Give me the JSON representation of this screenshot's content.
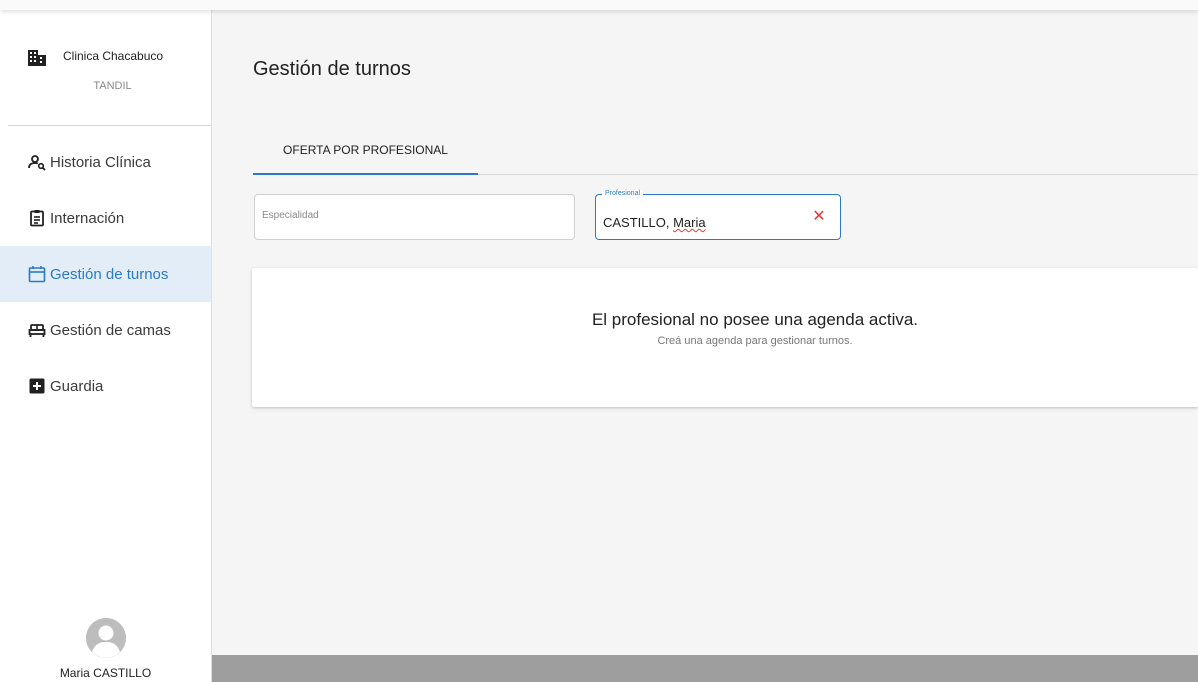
{
  "sidebar": {
    "clinic_name": "Clinica Chacabuco",
    "clinic_city": "TANDIL",
    "items": [
      {
        "label": "Historia Clínica",
        "icon": "user-search-icon"
      },
      {
        "label": "Internación",
        "icon": "clipboard-icon"
      },
      {
        "label": "Gestión de turnos",
        "icon": "calendar-icon",
        "active": true
      },
      {
        "label": "Gestión de camas",
        "icon": "bed-icon"
      },
      {
        "label": "Guardia",
        "icon": "plus-box-icon"
      }
    ],
    "user_name": "Maria CASTILLO"
  },
  "main": {
    "title": "Gestión de turnos",
    "tabs": [
      {
        "label": "OFERTA POR PROFESIONAL",
        "active": true
      }
    ],
    "filters": {
      "especialidad_placeholder": "Especialidad",
      "profesional_label": "Profesional",
      "profesional_value_prefix": "CASTILLO, ",
      "profesional_value_name": "Maria",
      "clear_symbol": "✕"
    },
    "empty_state": {
      "title": "El profesional no posee una agenda activa.",
      "subtitle": "Creá una agenda para gestionar turnos."
    }
  },
  "colors": {
    "accent": "#2b79c2",
    "active_bg": "#e3edf8",
    "error": "#e53935",
    "footer": "#9e9e9e"
  }
}
